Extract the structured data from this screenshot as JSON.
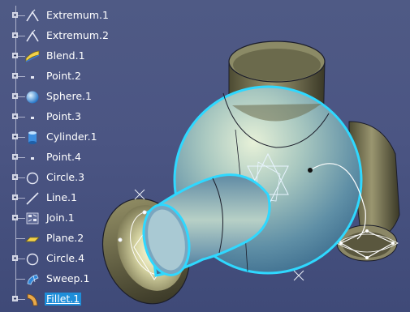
{
  "viewport": {
    "background_color": "#4b5583",
    "highlight_color": "#2fd8ff"
  },
  "tree": {
    "items": [
      {
        "label": "Extremum.1",
        "icon": "extremum-icon",
        "expandable": true
      },
      {
        "label": "Extremum.2",
        "icon": "extremum-icon",
        "expandable": true
      },
      {
        "label": "Blend.1",
        "icon": "blend-icon",
        "expandable": true
      },
      {
        "label": "Point.2",
        "icon": "point-icon",
        "expandable": true
      },
      {
        "label": "Sphere.1",
        "icon": "sphere-icon",
        "expandable": true
      },
      {
        "label": "Point.3",
        "icon": "point-icon",
        "expandable": true
      },
      {
        "label": "Cylinder.1",
        "icon": "cylinder-icon",
        "expandable": true
      },
      {
        "label": "Point.4",
        "icon": "point-icon",
        "expandable": true
      },
      {
        "label": "Circle.3",
        "icon": "circle-icon",
        "expandable": true
      },
      {
        "label": "Line.1",
        "icon": "line-icon",
        "expandable": true
      },
      {
        "label": "Join.1",
        "icon": "join-icon",
        "expandable": true
      },
      {
        "label": "Plane.2",
        "icon": "plane-icon",
        "expandable": false
      },
      {
        "label": "Circle.4",
        "icon": "circle-icon",
        "expandable": true
      },
      {
        "label": "Sweep.1",
        "icon": "sweep-icon",
        "expandable": false
      },
      {
        "label": "Fillet.1",
        "icon": "fillet-icon",
        "expandable": true,
        "selected": true
      }
    ]
  }
}
